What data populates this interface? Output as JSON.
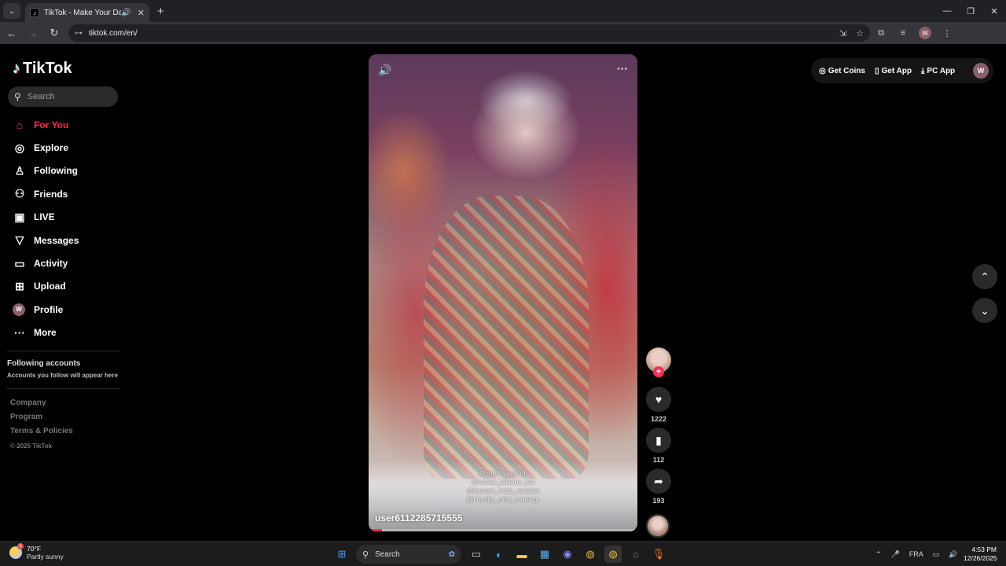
{
  "browser": {
    "tab_title": "TikTok - Make Your Day",
    "url": "tiktok.com/en/",
    "profile_initial": "W"
  },
  "sidebar": {
    "logo_text": "TikTok",
    "search_placeholder": "Search",
    "items": [
      {
        "label": "For You",
        "icon": "home-icon",
        "active": true
      },
      {
        "label": "Explore",
        "icon": "compass-icon"
      },
      {
        "label": "Following",
        "icon": "person-follow-icon"
      },
      {
        "label": "Friends",
        "icon": "friends-icon"
      },
      {
        "label": "LIVE",
        "icon": "live-icon"
      },
      {
        "label": "Messages",
        "icon": "messages-icon"
      },
      {
        "label": "Activity",
        "icon": "activity-icon"
      },
      {
        "label": "Upload",
        "icon": "upload-icon"
      },
      {
        "label": "Profile",
        "icon": "profile-avatar",
        "initial": "W"
      },
      {
        "label": "More",
        "icon": "more-dots-icon"
      }
    ],
    "following_title": "Following accounts",
    "following_sub": "Accounts you follow will appear here",
    "footer": [
      "Company",
      "Program",
      "Terms & Policies"
    ],
    "copyright": "© 2025 TikTok"
  },
  "video": {
    "username": "user6112285715555",
    "overlay_lines": [
      "@cheikhpassion",
      "@sanae_taleanc_ma",
      "@hassan_haza_malakia",
      "@khadija_robe_mariage"
    ],
    "progress": 0.05
  },
  "actions": {
    "likes": "1222",
    "saves": "112",
    "shares": "193"
  },
  "topbar": {
    "get_coins": "Get Coins",
    "get_app": "Get App",
    "pc_app": "PC App",
    "avatar_initial": "W"
  },
  "taskbar": {
    "temperature": "70°F",
    "condition": "Partly sunny",
    "search": "Search",
    "language": "FRA",
    "time": "4:53 PM",
    "date": "12/26/2025"
  },
  "colors": {
    "accent": "#fe2c55",
    "background": "#000000"
  }
}
